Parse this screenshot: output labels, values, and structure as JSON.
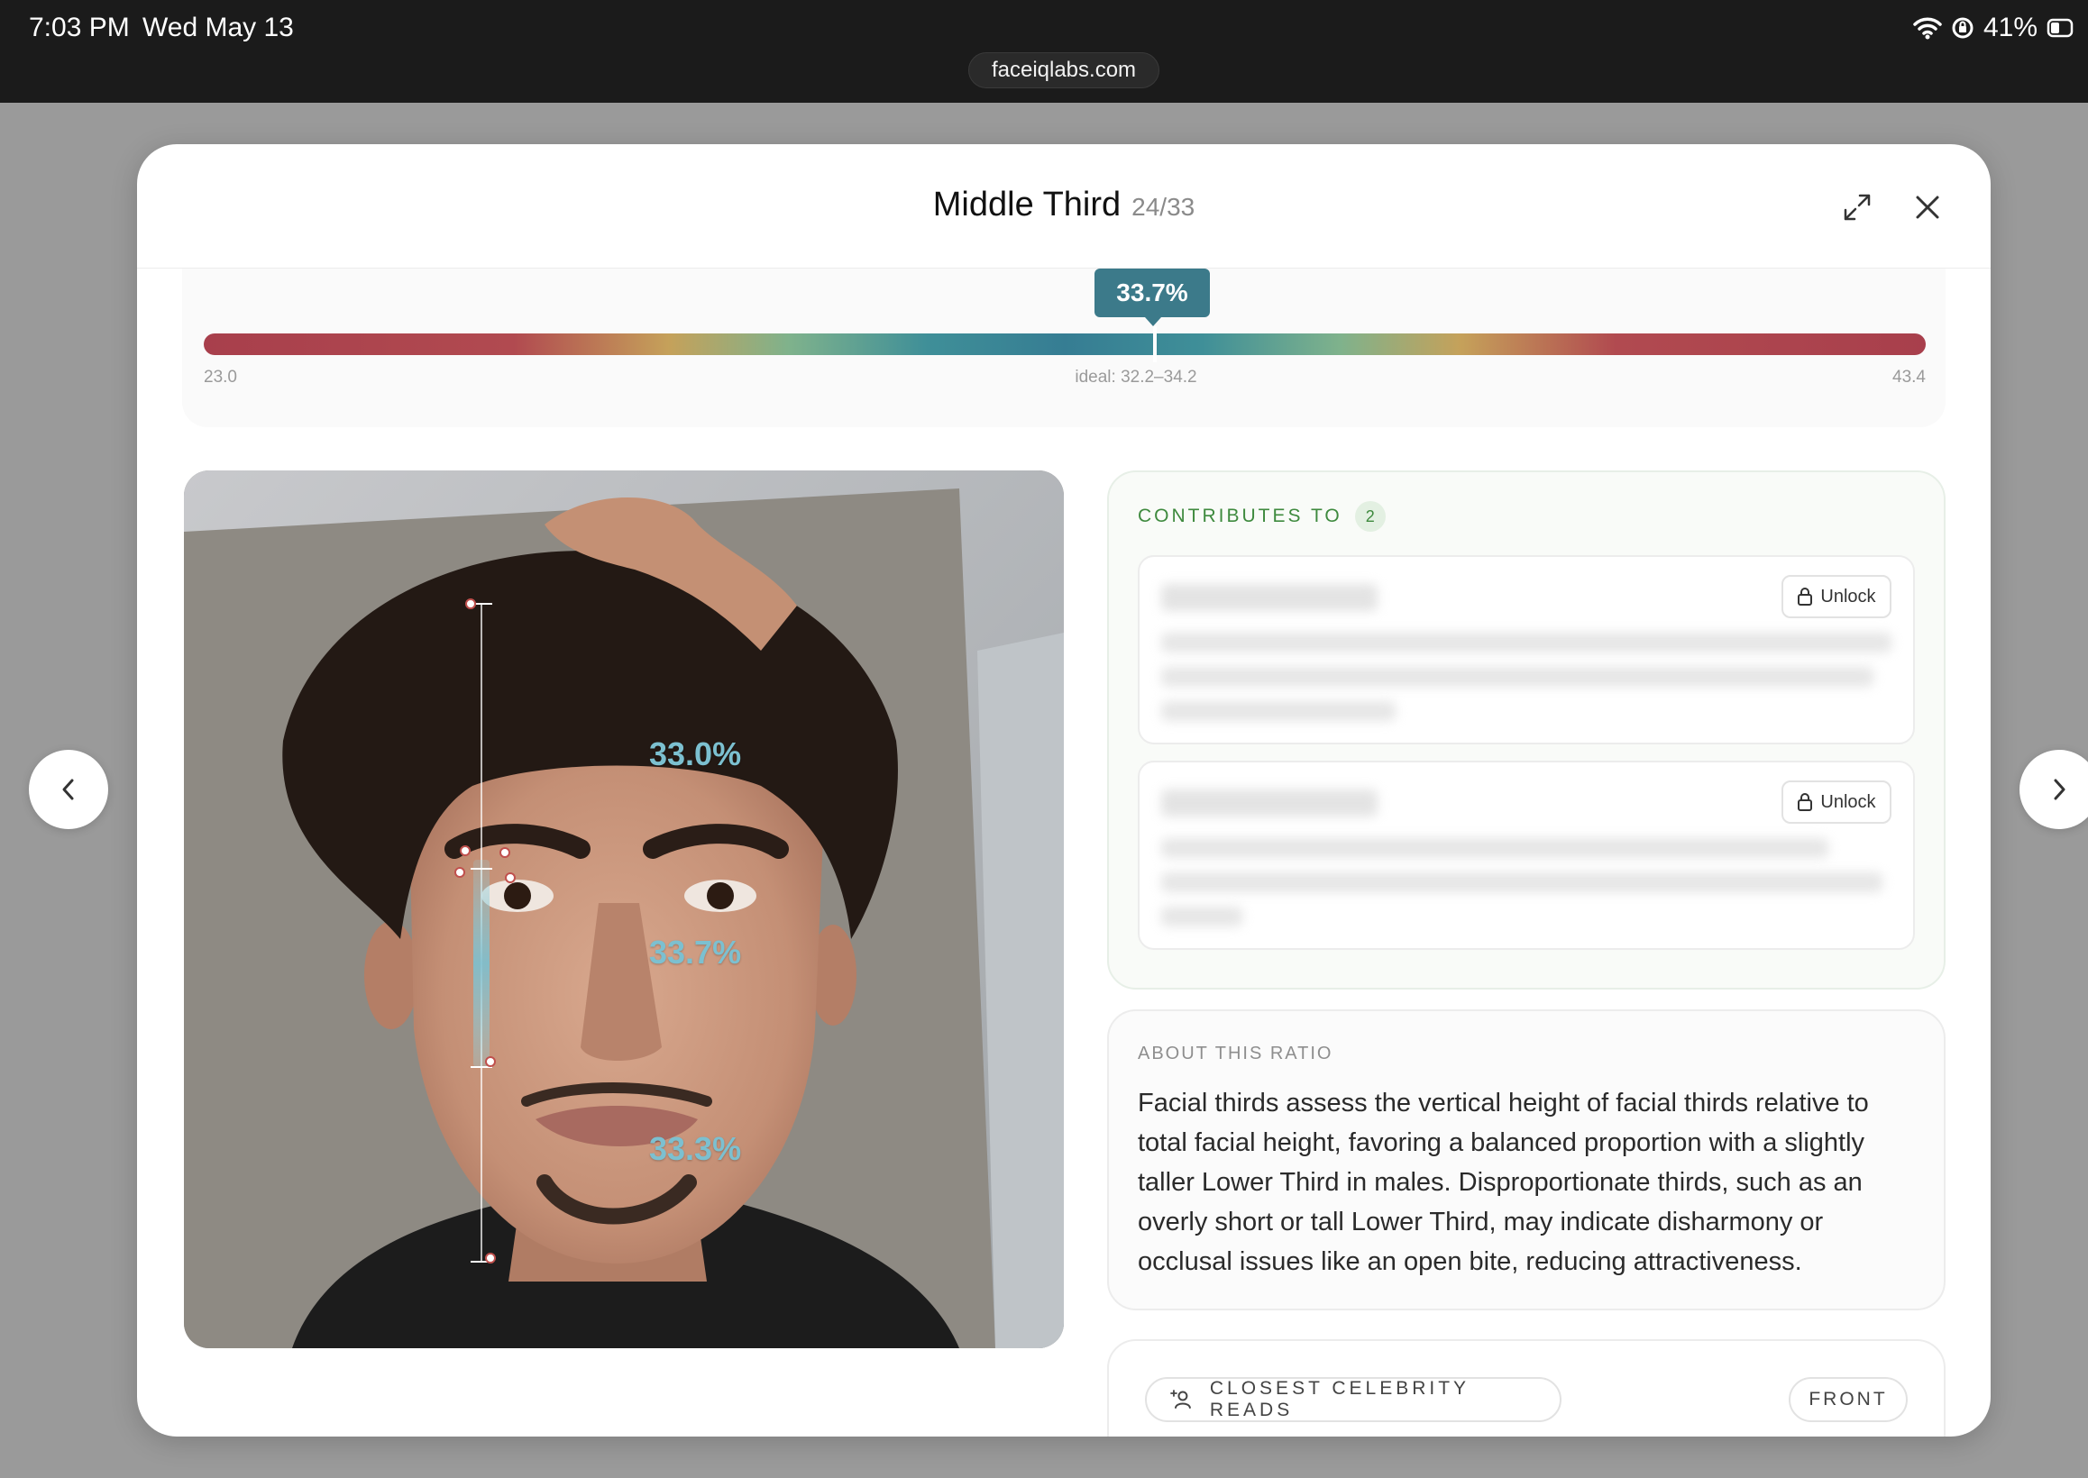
{
  "status_bar": {
    "time": "7:03 PM",
    "date": "Wed May 13",
    "battery": "41%",
    "url": "faceiqlabs.com"
  },
  "modal": {
    "title": "Middle Third",
    "count": "24/33"
  },
  "gauge": {
    "value_label": "33.7%",
    "value": 33.7,
    "min_label": "23.0",
    "ideal_label": "ideal: 32.2–34.2",
    "max_label": "43.4"
  },
  "photo": {
    "upper_label": "33.0%",
    "middle_label": "33.7%",
    "lower_label": "33.3%"
  },
  "contributes": {
    "heading": "CONTRIBUTES TO",
    "badge": "2",
    "items": [
      {
        "unlock_label": "Unlock"
      },
      {
        "unlock_label": "Unlock"
      }
    ]
  },
  "about": {
    "heading": "ABOUT THIS RATIO",
    "text": "Facial thirds assess the vertical height of facial thirds relative to total facial height, favoring a balanced proportion with a slightly taller Lower Third in males. Disproportionate thirds, such as an overly short or tall Lower Third, may indicate disharmony or occlusal issues like an open bite, reducing attractiveness."
  },
  "celebrity": {
    "label": "CLOSEST CELEBRITY READS",
    "view": "FRONT"
  },
  "colors": {
    "accent": "#3c7a8a",
    "contrib_green": "#3e8a3e",
    "measure_line": "#7cc0d0"
  }
}
